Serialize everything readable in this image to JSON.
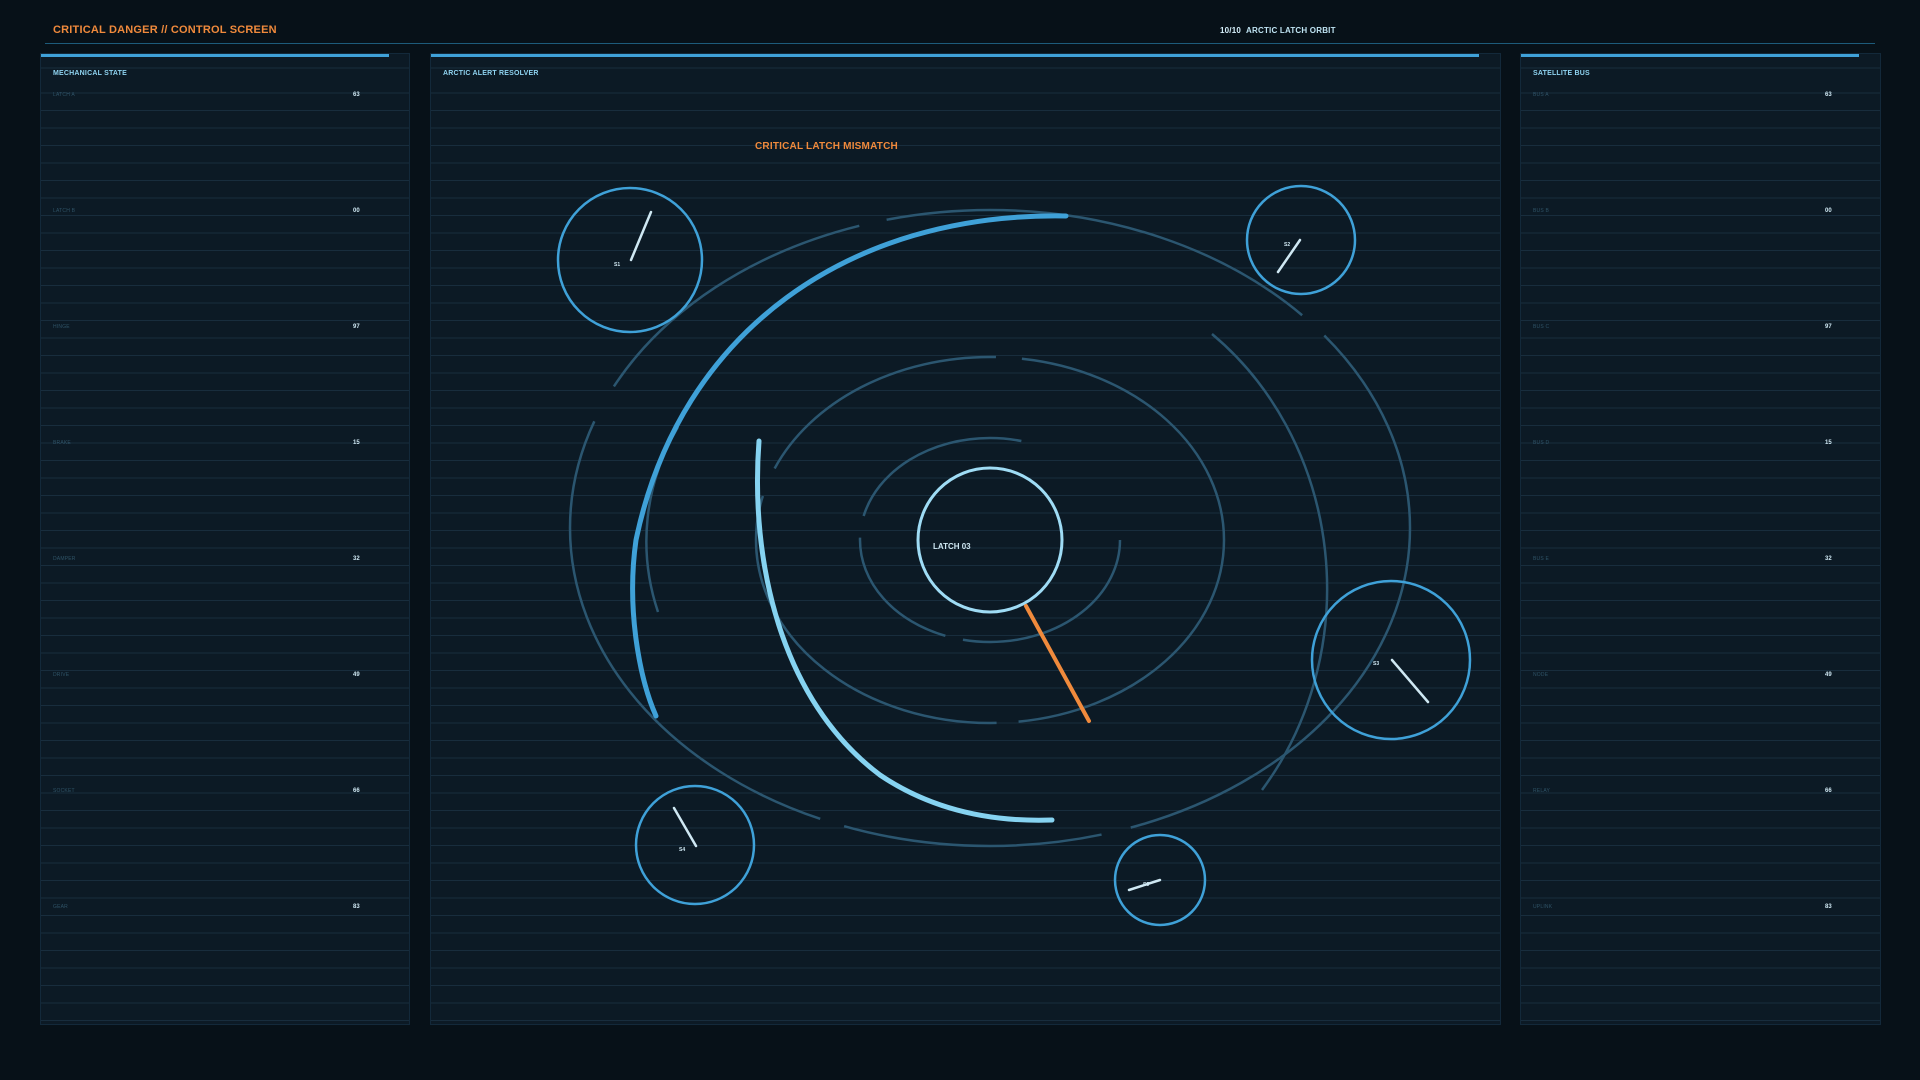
{
  "header": {
    "title": "CRITICAL DANGER // CONTROL SCREEN",
    "ratio": "10/10",
    "status": "ARCTIC LATCH ORBIT"
  },
  "colors": {
    "background": "#071118",
    "panel": "#0c1a25",
    "accent": "#3fa1d8",
    "alert": "#f08a3c",
    "text": "#cfe8f3"
  },
  "left_panel": {
    "title": "MECHANICAL STATE",
    "rows": [
      {
        "label": "LATCH A",
        "value": "63"
      },
      {
        "label": "LATCH B",
        "value": "00"
      },
      {
        "label": "HINGE",
        "value": "97"
      },
      {
        "label": "BRAKE",
        "value": "15"
      },
      {
        "label": "DAMPER",
        "value": "32"
      },
      {
        "label": "DRIVE",
        "value": "49"
      },
      {
        "label": "SOCKET",
        "value": "66"
      },
      {
        "label": "GEAR",
        "value": "83"
      }
    ]
  },
  "center_panel": {
    "title": "ARCTIC ALERT RESOLVER",
    "alert": "CRITICAL LATCH MISMATCH",
    "core_label": "LATCH 03",
    "satellites": [
      {
        "label": "S1"
      },
      {
        "label": "S2"
      },
      {
        "label": "S3"
      },
      {
        "label": "S4"
      },
      {
        "label": "S5"
      }
    ]
  },
  "right_panel": {
    "title": "SATELLITE BUS",
    "rows": [
      {
        "label": "BUS A",
        "value": "63"
      },
      {
        "label": "BUS B",
        "value": "00"
      },
      {
        "label": "BUS C",
        "value": "97"
      },
      {
        "label": "BUS D",
        "value": "15"
      },
      {
        "label": "BUS E",
        "value": "32"
      },
      {
        "label": "NODE",
        "value": "49"
      },
      {
        "label": "RELAY",
        "value": "66"
      },
      {
        "label": "UPLINK",
        "value": "83"
      }
    ]
  }
}
